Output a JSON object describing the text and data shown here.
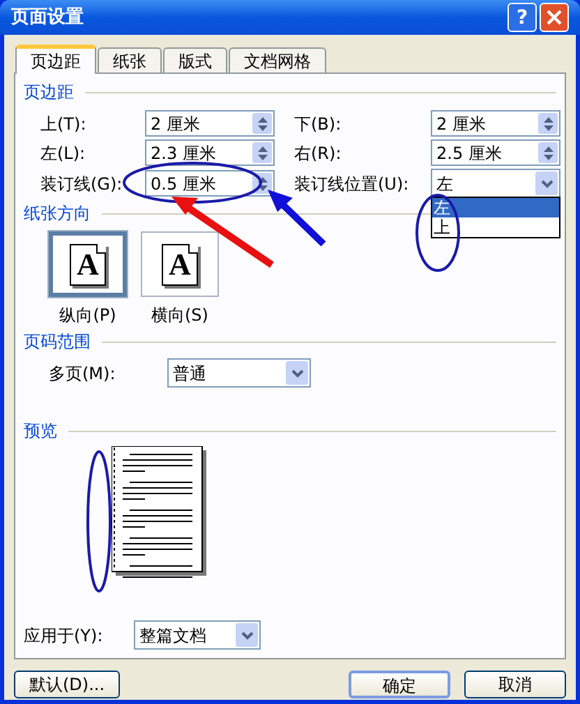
{
  "window": {
    "title": "页面设置",
    "help": "?"
  },
  "tabs": [
    {
      "label": "页边距",
      "selected": true
    },
    {
      "label": "纸张",
      "selected": false
    },
    {
      "label": "版式",
      "selected": false
    },
    {
      "label": "文档网格",
      "selected": false
    }
  ],
  "margins": {
    "title": "页边距",
    "fields": [
      {
        "label": "上(T):",
        "value": "2 厘米"
      },
      {
        "label": "下(B):",
        "value": "2 厘米"
      },
      {
        "label": "左(L):",
        "value": "2.3 厘米"
      },
      {
        "label": "右(R):",
        "value": "2.5 厘米"
      },
      {
        "label": "装订线(G):",
        "value": "0.5 厘米"
      }
    ],
    "gutter_position": {
      "label": "装订线位置(U):",
      "value": "左",
      "expanded": true,
      "options": [
        {
          "label": "左",
          "selected": true
        },
        {
          "label": "上",
          "selected": false
        }
      ]
    }
  },
  "orientation": {
    "title": "纸张方向",
    "options": [
      {
        "label": "纵向(P)",
        "glyph": "A",
        "selected": true
      },
      {
        "label": "横向(S)",
        "glyph": "A",
        "selected": false
      }
    ]
  },
  "pages": {
    "title": "页码范围",
    "label": "多页(M):",
    "value": "普通"
  },
  "preview": {
    "title": "预览"
  },
  "apply": {
    "label": "应用于(Y):",
    "value": "整篇文档"
  },
  "buttons": [
    {
      "label": "默认(D)...",
      "default": false
    },
    {
      "label": "确定",
      "default": true
    },
    {
      "label": "取消",
      "default": false
    }
  ]
}
